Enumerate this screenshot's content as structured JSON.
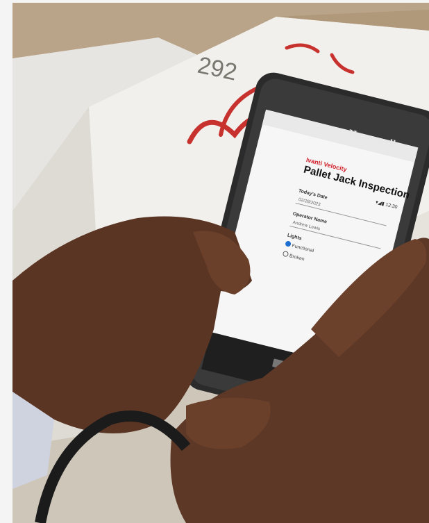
{
  "photo": {
    "alt": "Hands holding a Honeywell mobile computer showing an Ivanti Velocity form in front of cardboard boxes"
  },
  "box_markings": {
    "number": "292"
  },
  "device": {
    "brand": "Honeywell"
  },
  "screen": {
    "status_bar": "▾◢▮ 12:30",
    "app_name": "Ivanti Velocity",
    "title": "Pallet Jack Inspection",
    "date_label": "Today's Date",
    "date_value": "02/28/2023",
    "operator_label": "Operator Name",
    "operator_value": "Andrew Lewis",
    "lights_label": "Lights",
    "option_1": "Functional",
    "option_2": "Broken"
  }
}
